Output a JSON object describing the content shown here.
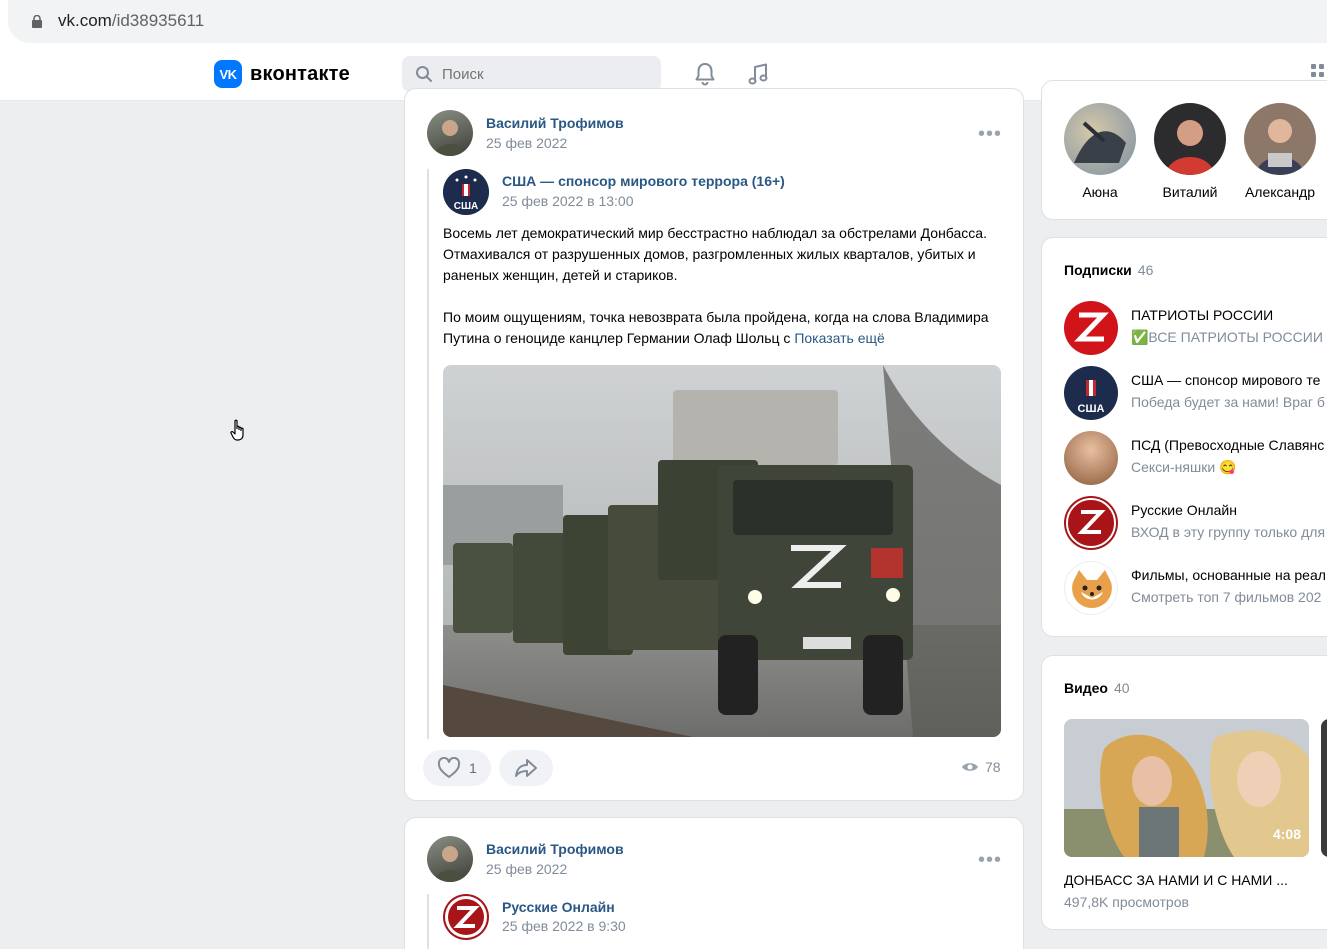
{
  "browser": {
    "url_host": "vk.com",
    "url_path": "/id38935611"
  },
  "header": {
    "brand": "вконтакте",
    "logo_mark": "VK",
    "search_placeholder": "Поиск",
    "icons": [
      "bell-icon",
      "music-icon",
      "apps-icon"
    ]
  },
  "posts": [
    {
      "author": "Василий Трофимов",
      "date": "25 фев 2022",
      "repost": {
        "source": "США — спонсор мирового террора (16+)",
        "date": "25 фев 2022 в 13:00",
        "paragraph1": "Восемь лет демократический мир бесстрастно наблюдал за обстрелами Донбасса. Отмахивался от разрушенных домов, разгромленных жилых кварталов, убитых и раненых женщин, детей и стариков.",
        "paragraph2": "По моим ощущениям, точка невозврата была пройдена, когда на слова Владимира Путина о геноциде канцлер Германии Олаф Шольц с",
        "show_more": "Показать ещё"
      },
      "likes": "1",
      "views": "78"
    },
    {
      "author": "Василий Трофимов",
      "date": "25 фев 2022",
      "repost": {
        "source": "Русские Онлайн",
        "date": "25 фев 2022 в 9:30"
      }
    }
  ],
  "friends": [
    {
      "name": "Аюна"
    },
    {
      "name": "Виталий"
    },
    {
      "name": "Александр"
    }
  ],
  "subscriptions": {
    "title": "Подписки",
    "count": "46",
    "items": [
      {
        "name": "ПАТРИОТЫ РОССИИ",
        "desc": "✅ВСЕ ПАТРИОТЫ РОССИИ С",
        "avatar_color": "#d0141a"
      },
      {
        "name": "США — спонсор мирового те",
        "desc": "Победа будет за нами! Враг б",
        "avatar_color": "#1d2c4c"
      },
      {
        "name": "ПСД (Превосходные Славянс",
        "desc": "Секси-няшки 😋",
        "avatar_color": "#c08a6a"
      },
      {
        "name": "Русские Онлайн",
        "desc": "ВХОД в эту группу только для",
        "avatar_color": "#a81418"
      },
      {
        "name": "Фильмы, основанные на реал",
        "desc": "Смотреть топ 7 фильмов 202",
        "avatar_color": "#e9a04a"
      }
    ]
  },
  "videos": {
    "title": "Видео",
    "count": "40",
    "items": [
      {
        "title": "ДОНБАСС ЗА НАМИ И С НАМИ ...",
        "views": "497,8K просмотров",
        "duration": "4:08"
      }
    ]
  },
  "colors": {
    "accent": "#0077ff",
    "link": "#2a5885",
    "muted": "#818c99",
    "bg": "#edeef0"
  }
}
